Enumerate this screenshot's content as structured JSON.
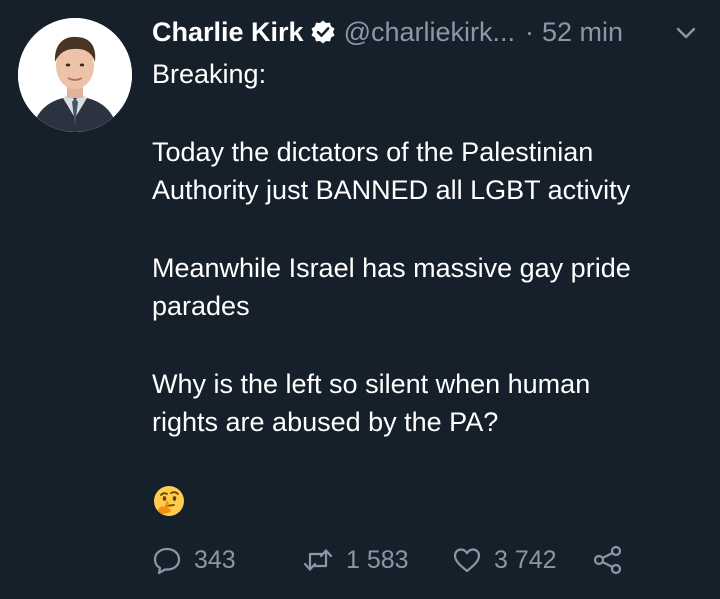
{
  "author": {
    "name": "Charlie Kirk",
    "handle": "@charliekirk...",
    "separator": "·",
    "time": "52 min",
    "verified": true
  },
  "tweet": {
    "lines": [
      "Breaking:",
      "",
      "Today the dictators of the Palestinian",
      "Authority just BANNED all LGBT activity",
      "",
      "Meanwhile Israel has massive gay pride",
      "parades",
      "",
      "Why is the left so silent when human",
      "rights are abused by the PA?"
    ],
    "emoji": "thinking-face"
  },
  "actions": {
    "replies": "343",
    "retweets": "1 583",
    "likes": "3 742"
  },
  "icons": [
    "verified-badge-icon",
    "chevron-down-icon",
    "reply-icon",
    "retweet-icon",
    "like-icon",
    "share-icon",
    "thinking-face-emoji"
  ],
  "colors": {
    "background": "#15202b",
    "text": "#ffffff",
    "secondary_text": "#8899a6"
  }
}
